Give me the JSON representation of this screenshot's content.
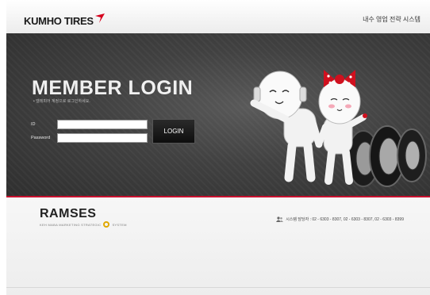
{
  "header": {
    "brand_name": "KUMHO TIRES",
    "system_title": "내수 영업 전략 시스템"
  },
  "login": {
    "title": "MEMBER LOGIN",
    "subtitle": "• 델레피어 계정으로 로그인하세요.",
    "id_label": "ID",
    "id_value": "",
    "password_label": "Password",
    "password_value": "",
    "button_label": "LOGIN"
  },
  "footer": {
    "product_name": "RAMSES",
    "product_tagline": "KEH MABA MARKETING STRATEGIC",
    "partner_name": "SYSTEM",
    "contact": "시스템 담당자 : 02 - 6303 - 8307, 02 - 6303 - 8307, 02 - 6303 - 8399"
  },
  "colors": {
    "brand_red": "#c8102e",
    "hero_background": "#414141"
  },
  "icons": [
    "kumho-wing-icon",
    "people-icon",
    "system-logo-icon"
  ]
}
